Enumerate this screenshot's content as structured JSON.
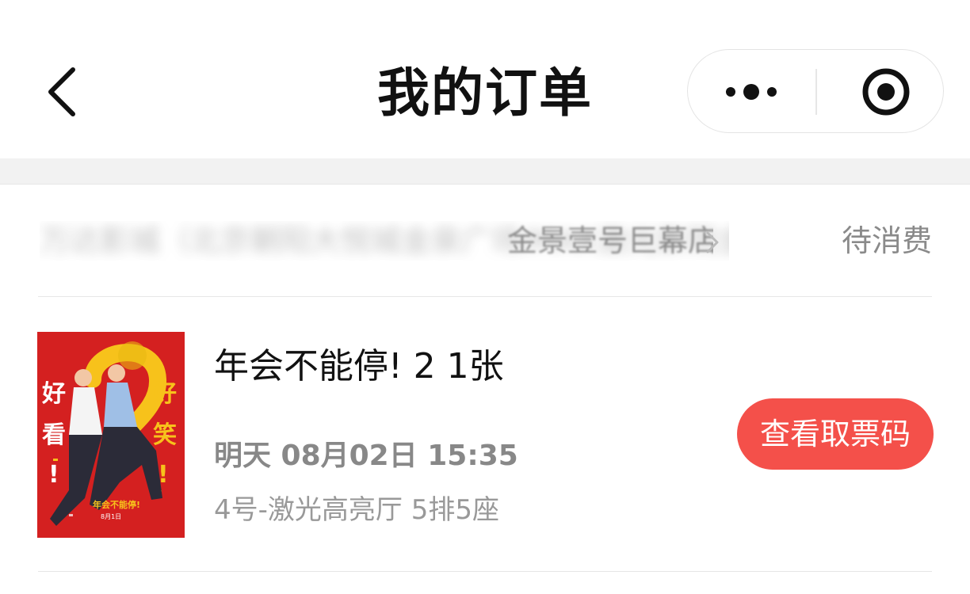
{
  "header": {
    "title": "我的订单",
    "back_icon": "chevron-left-icon",
    "capsule": {
      "more_icon": "more-dots-icon",
      "close_icon": "target-circle-icon"
    }
  },
  "order": {
    "store_name": "万达影城（北京朝阳大悦城金泉广场IMAX激光影院金景壹号巨幕店）",
    "store_name_visible_tail": "金景壹号巨幕店)",
    "status": "待消费",
    "movie_title": "年会不能停! 2 1张",
    "showtime": "明天 08月02日 15:35",
    "seat_info": "4号-激光高亮厅 5排5座",
    "view_ticket_button": "查看取票码",
    "poster": {
      "left_text": [
        "好",
        "看",
        "!"
      ],
      "right_text": [
        "好",
        "笑",
        "!"
      ],
      "title_overlay": "年会不能停!",
      "date_overlay": "8月1日",
      "colors": {
        "background": "#d42020",
        "accent": "#f7c21b"
      }
    }
  },
  "colors": {
    "accent_button": "#f4504a",
    "status_text": "#8a8a8a",
    "secondary_text": "#888888",
    "band": "#f2f2f2"
  }
}
